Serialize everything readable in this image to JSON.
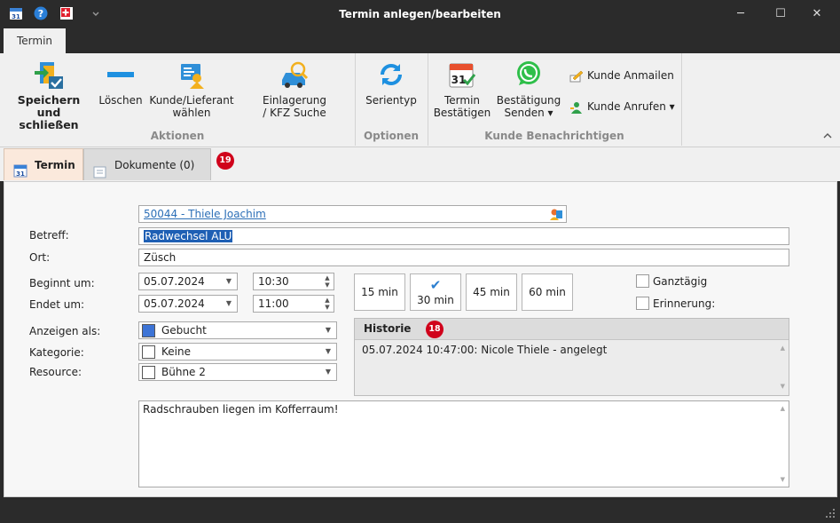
{
  "window": {
    "title": "Termin anlegen/bearbeiten",
    "minimize": "─",
    "maximize": "☐",
    "close": "✕"
  },
  "quick_access": {
    "calendar_day": "31",
    "help": "?"
  },
  "ribbon_tab": "Termin",
  "ribbon": {
    "save_close": [
      "Speichern und",
      "schließen"
    ],
    "delete": "Löschen",
    "customer_select": [
      "Kunde/Lieferant",
      "wählen"
    ],
    "storage": [
      "Einlagerung",
      "/ KFZ Suche"
    ],
    "series": "Serientyp",
    "confirm": [
      "Termin",
      "Bestätigen"
    ],
    "send_confirm": [
      "Bestätigung",
      "Senden ▾"
    ],
    "mail_customer": "Kunde Anmailen",
    "call_customer": "Kunde Anrufen ▾",
    "group_actions": "Aktionen",
    "group_options": "Optionen",
    "group_notify": "Kunde Benachrichtigen",
    "confirm_day": "31"
  },
  "tabs": {
    "termin": "Termin",
    "documents": "Dokumente (0)",
    "documents_badge": "19",
    "calendar_day": "31"
  },
  "form": {
    "customer_link": "50044 - Thiele Joachim",
    "subject_label": "Betreff:",
    "subject": "Radwechsel ALU",
    "location_label": "Ort:",
    "location": "Züsch",
    "start_label": "Beginnt um:",
    "start_date": "05.07.2024",
    "start_time": "10:30",
    "end_label": "Endet um:",
    "end_date": "05.07.2024",
    "end_time": "11:00",
    "durations": [
      "15 min",
      "30 min",
      "45 min",
      "60 min"
    ],
    "selected_duration_check": "✔",
    "all_day": "Ganztägig",
    "reminder": "Erinnerung:",
    "show_as_label": "Anzeigen als:",
    "show_as": "Gebucht",
    "show_as_color": "#3d74d6",
    "category_label": "Kategorie:",
    "category": "Keine",
    "resource_label": "Resource:",
    "resource": "Bühne 2",
    "history_title": "Historie",
    "history_badge": "18",
    "history_entry": "05.07.2024 10:47:00: Nicole Thiele - angelegt",
    "notes": "Radschrauben liegen im Kofferraum!"
  },
  "colors": {
    "accent": "#2c6fb7",
    "badge": "#d0021b",
    "selection": "#1e5fb4"
  }
}
